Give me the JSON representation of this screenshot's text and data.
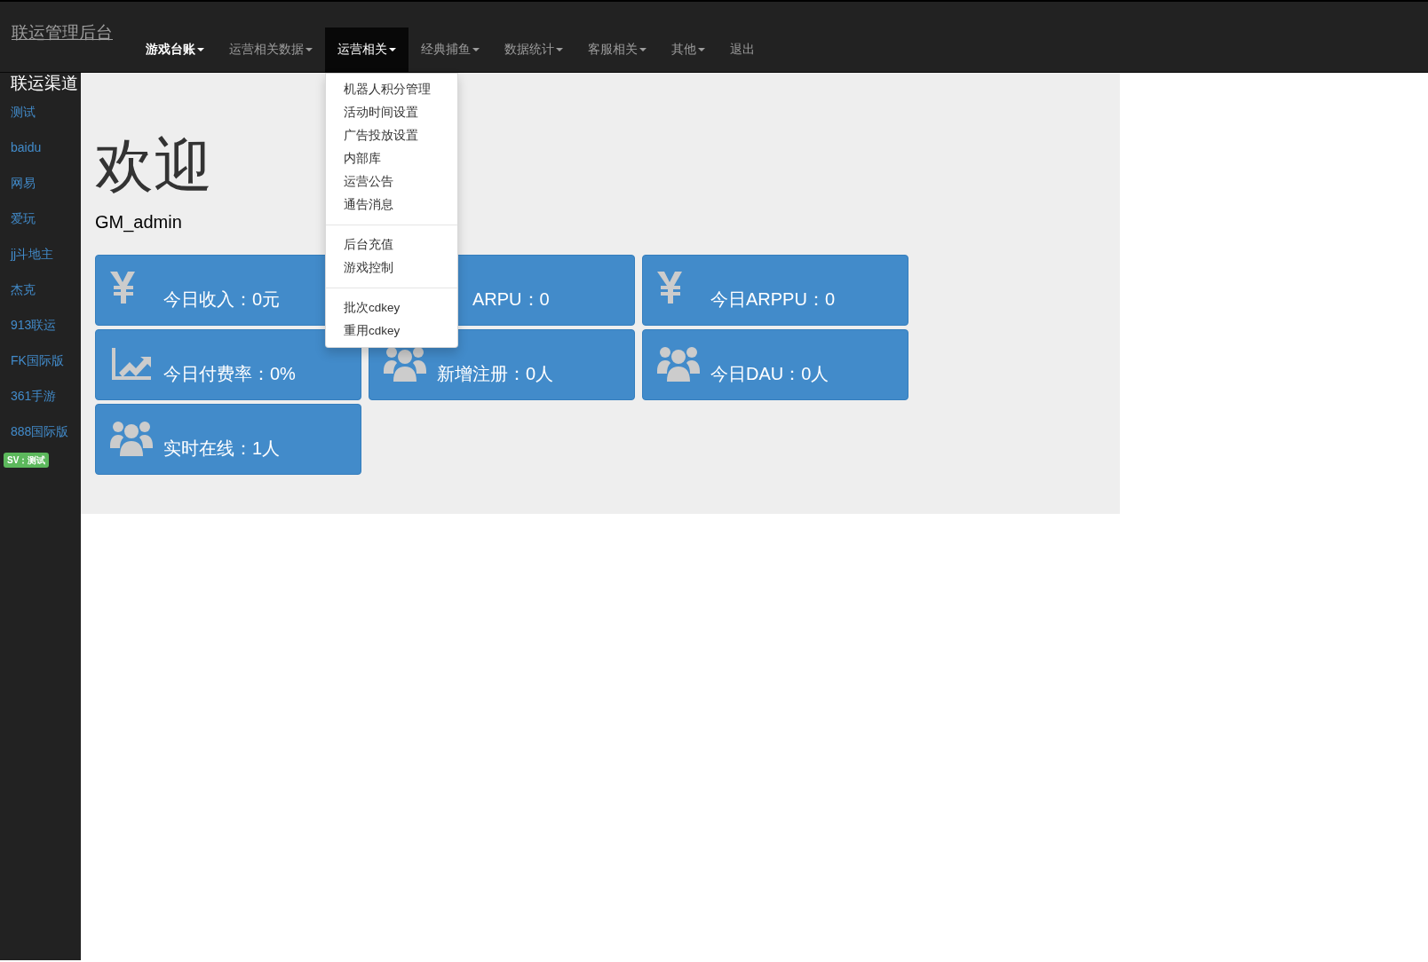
{
  "brand": "联运管理后台",
  "nav": [
    {
      "label": "游戏台账",
      "dropdown": true,
      "selected": false,
      "highlighted": true
    },
    {
      "label": "运营相关数据",
      "dropdown": true,
      "selected": false,
      "highlighted": false
    },
    {
      "label": "运营相关",
      "dropdown": true,
      "selected": true,
      "highlighted": false
    },
    {
      "label": "经典捕鱼",
      "dropdown": true,
      "selected": false,
      "highlighted": false
    },
    {
      "label": "数据统计",
      "dropdown": true,
      "selected": false,
      "highlighted": false
    },
    {
      "label": "客服相关",
      "dropdown": true,
      "selected": false,
      "highlighted": false
    },
    {
      "label": "其他",
      "dropdown": true,
      "selected": false,
      "highlighted": false
    },
    {
      "label": "退出",
      "dropdown": false,
      "selected": false,
      "highlighted": false
    }
  ],
  "dropdown_menu": {
    "groups": [
      [
        "机器人积分管理",
        "活动时间设置",
        "广告投放设置",
        "内部库",
        "运营公告",
        "通告消息"
      ],
      [
        "后台充值",
        "游戏控制"
      ],
      [
        "批次cdkey",
        "重用cdkey"
      ]
    ]
  },
  "sidebar": {
    "title": "联运渠道",
    "items": [
      "测试",
      "baidu",
      "网易",
      "爱玩",
      "jj斗地主",
      "杰克",
      "913联运",
      "FK国际版",
      "361手游",
      "888国际版"
    ],
    "badge": "SV：测试"
  },
  "welcome": {
    "heading": "欢迎",
    "user": "GM_admin"
  },
  "cards": [
    {
      "kind": "yen",
      "text": "今日收入：0元"
    },
    {
      "kind": "covered",
      "text": "ARPU：0"
    },
    {
      "kind": "yen",
      "text": "今日ARPPU：0"
    },
    {
      "kind": "chart",
      "text": "今日付费率：0%"
    },
    {
      "kind": "users",
      "text": "新增注册：0人"
    },
    {
      "kind": "users",
      "text": "今日DAU：0人"
    },
    {
      "kind": "users",
      "text": "实时在线：1人"
    }
  ]
}
